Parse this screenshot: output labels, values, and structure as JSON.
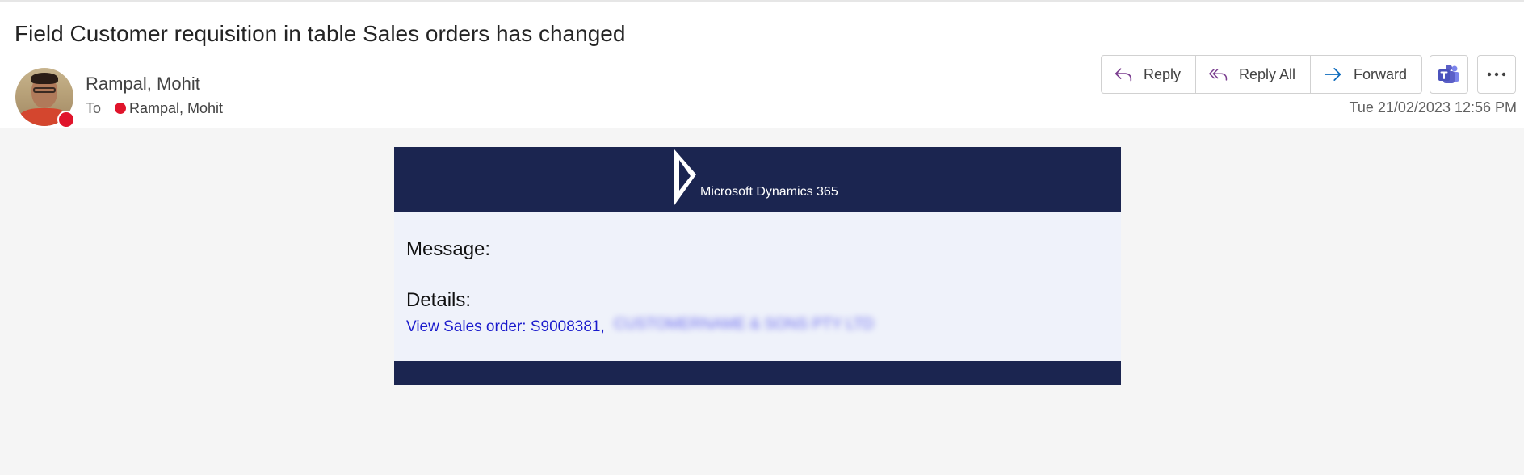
{
  "email": {
    "subject": "Field Customer requisition in table Sales orders has changed",
    "sender": "Rampal, Mohit",
    "to_label": "To",
    "recipient": "Rampal, Mohit",
    "date": "Tue 21/02/2023 12:56 PM"
  },
  "actions": {
    "reply": "Reply",
    "reply_all": "Reply All",
    "forward": "Forward",
    "teams_icon": "teams-icon",
    "more_icon": "more-options-icon"
  },
  "body": {
    "brand": "Microsoft Dynamics 365",
    "message_label": "Message:",
    "details_label": "Details:",
    "link_text": "View Sales order: S9008381,",
    "customer_text": "CUSTOMERNAME & SONS PTY LTD"
  },
  "colors": {
    "banner": "#1b2550",
    "card_body": "#eff2fa",
    "link": "#1a1acc",
    "presence_busy": "#e0142b",
    "reply_icon": "#7a3d8f",
    "forward_icon": "#0f6cbd",
    "teams": "#5b5fc7"
  }
}
